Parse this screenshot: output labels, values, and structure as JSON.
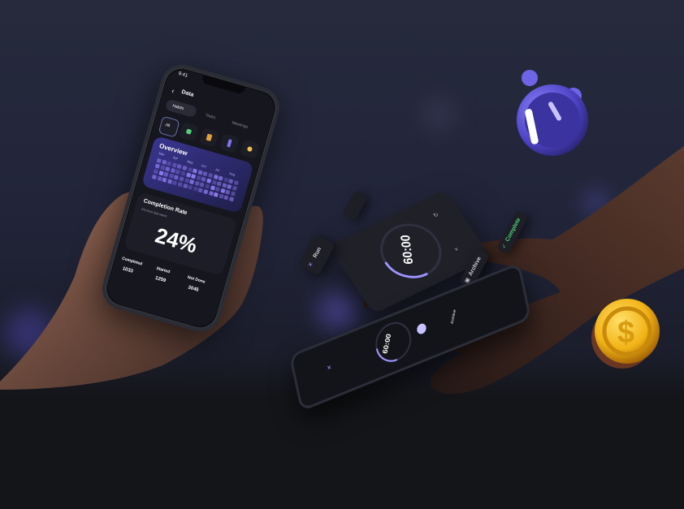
{
  "phone_left": {
    "status_time": "9:41",
    "header_title": "Data",
    "tabs": [
      "Habits",
      "Tasks",
      "Meetings"
    ],
    "category_all": "All",
    "overview_title": "Overview",
    "months": [
      "Mar",
      "Apr",
      "May",
      "Jun",
      "Jul",
      "Aug"
    ],
    "completion_title": "Completion Rate",
    "completion_sub": "2% from last week",
    "completion_value": "24%",
    "stats": [
      {
        "label": "Completed",
        "value": "1033"
      },
      {
        "label": "Started",
        "value": "1259"
      },
      {
        "label": "Not Done",
        "value": "3045"
      }
    ]
  },
  "timer_card": {
    "time": "60:00",
    "activity_label": "Run"
  },
  "floating_tags": {
    "complete": "Complete",
    "archive": "Archive"
  },
  "phone_right": {
    "time": "60:00",
    "side_label": "Archive"
  },
  "colors": {
    "accent": "#8f7cf0",
    "coin": "#f2b316",
    "clock": "#5b4fd6"
  }
}
